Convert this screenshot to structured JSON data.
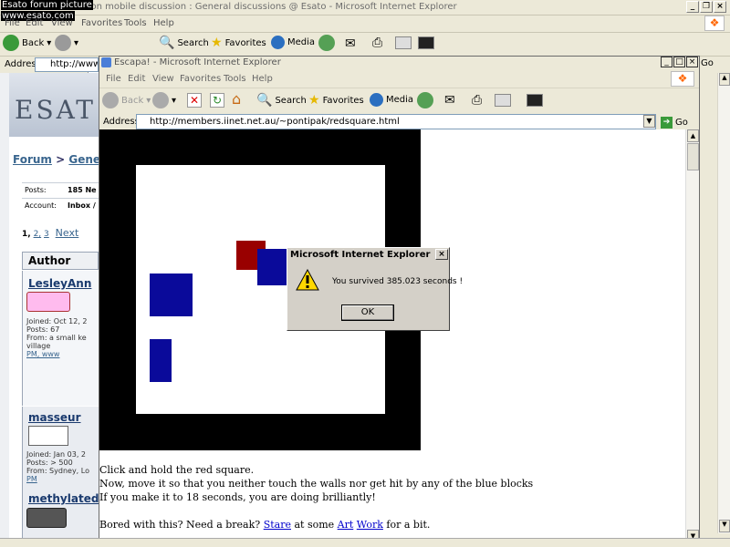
{
  "overlay_caption": [
    "Esato forum picture",
    "www.esato.com"
  ],
  "back_window": {
    "title": "Non mobile discussion : General discussions @ Esato - Microsoft Internet Explorer",
    "menu": [
      "File",
      "Edit",
      "View",
      "Favorites",
      "Tools",
      "Help"
    ],
    "toolbar": {
      "back": "Back",
      "search": "Search",
      "favorites": "Favorites",
      "media": "Media"
    },
    "address_label": "Address",
    "address_value": "http://www.e",
    "go": "Go"
  },
  "site": {
    "logo": "ESAT",
    "breadcrumb": {
      "forum": "Forum",
      "sep": " > ",
      "section": "Gene"
    },
    "posts_label": "Posts:",
    "posts_value": "185 Ne",
    "account_label": "Account:",
    "account_value": "Inbox /",
    "pager": {
      "current": "1,",
      "p2": "2,",
      "p3": "3",
      "next": "Next"
    },
    "author_header": "Author",
    "users": [
      {
        "name": "LesleyAnn",
        "joined": "Joined: Oct 12, 2",
        "posts": "Posts: 67",
        "from": "From: a small ke",
        "from2": "village",
        "links": "PM, www"
      },
      {
        "name": "masseur",
        "joined": "Joined: Jan 03, 2",
        "posts": "Posts: > 500",
        "from": "From: Sydney, Lo",
        "from2": "",
        "links": "PM"
      },
      {
        "name": "methylated",
        "joined": "",
        "posts": "",
        "from": "",
        "from2": "",
        "links": ""
      }
    ]
  },
  "front_window": {
    "title": "Escapa! - Microsoft Internet Explorer",
    "menu": [
      "File",
      "Edit",
      "View",
      "Favorites",
      "Tools",
      "Help"
    ],
    "toolbar": {
      "back": "Back",
      "search": "Search",
      "favorites": "Favorites",
      "media": "Media"
    },
    "address_label": "Address",
    "address_value": "http://members.iinet.net.au/~pontipak/redsquare.html",
    "go": "Go"
  },
  "game": {
    "instructions": [
      "Click and hold the red square.",
      "Now, move it so that you neither touch the walls nor get hit by any of the blue blocks",
      "If you make it to 18 seconds, you are doing brilliantly!"
    ],
    "bored_prefix": "Bored with this? Need a break?",
    "link_stare": "Stare",
    "mid1": "at some",
    "link_art": "Art",
    "link_work": "Work",
    "suffix": "for a bit."
  },
  "dialog": {
    "title": "Microsoft Internet Explorer",
    "message": "You survived 385.023 seconds !",
    "ok_label": "OK"
  },
  "colors": {
    "red_square": "#990000",
    "blue_block": "#0a0a9a",
    "wall": "#000000"
  }
}
